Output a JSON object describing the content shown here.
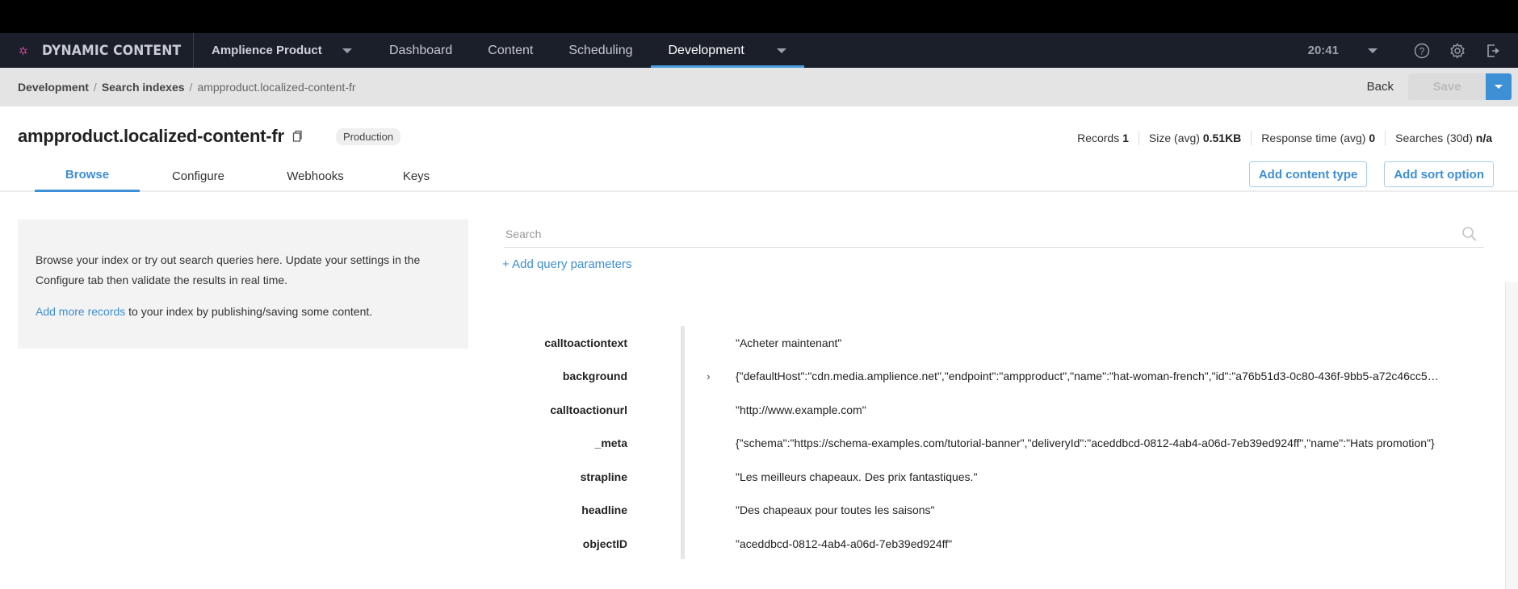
{
  "nav": {
    "brand": "DYNAMIC CONTENT",
    "hub": "Amplience Product",
    "tabs": [
      {
        "label": "Dashboard",
        "active": false
      },
      {
        "label": "Content",
        "active": false
      },
      {
        "label": "Scheduling",
        "active": false
      },
      {
        "label": "Development",
        "active": true
      }
    ],
    "clock": "20:41",
    "icons": [
      "help-icon",
      "gear-icon",
      "logout-icon"
    ],
    "accent": "#4a9de0"
  },
  "breadcrumb": {
    "items": [
      "Development",
      "Search indexes",
      "ampproduct.localized-content-fr"
    ],
    "back_label": "Back",
    "save_label": "Save"
  },
  "header": {
    "title": "ampproduct.localized-content-fr",
    "badge": "Production",
    "stats": [
      {
        "label": "Records",
        "value": "1"
      },
      {
        "label": "Size (avg)",
        "value": "0.51KB"
      },
      {
        "label": "Response time (avg)",
        "value": "0"
      },
      {
        "label": "Searches (30d)",
        "value": "n/a"
      }
    ],
    "tabs": [
      {
        "label": "Browse",
        "active": true
      },
      {
        "label": "Configure",
        "active": false
      },
      {
        "label": "Webhooks",
        "active": false
      },
      {
        "label": "Keys",
        "active": false
      }
    ],
    "add_content_type": "Add content type",
    "add_sort_option": "Add sort option"
  },
  "info": {
    "line1": "Browse your index or try out search queries here. Update your settings in the Configure tab then validate the results in real time.",
    "link": "Add more records",
    "line2_rest": " to your index by publishing/saving some content."
  },
  "search": {
    "placeholder": "Search",
    "value": "",
    "add_query": "+ Add query parameters"
  },
  "record": [
    {
      "key": "calltoactiontext",
      "expandable": false,
      "value": "\"Acheter maintenant\""
    },
    {
      "key": "background",
      "expandable": true,
      "value": "{\"defaultHost\":\"cdn.media.amplience.net\",\"endpoint\":\"ampproduct\",\"name\":\"hat-woman-french\",\"id\":\"a76b51d3-0c80-436f-9bb5-a72c46cc5…"
    },
    {
      "key": "calltoactionurl",
      "expandable": false,
      "value": "\"http://www.example.com\""
    },
    {
      "key": "_meta",
      "expandable": false,
      "value": "{\"schema\":\"https://schema-examples.com/tutorial-banner\",\"deliveryId\":\"aceddbcd-0812-4ab4-a06d-7eb39ed924ff\",\"name\":\"Hats promotion\"}"
    },
    {
      "key": "strapline",
      "expandable": false,
      "value": "\"Les meilleurs chapeaux. Des prix fantastiques.\""
    },
    {
      "key": "headline",
      "expandable": false,
      "value": "\"Des chapeaux pour toutes les saisons\""
    },
    {
      "key": "objectID",
      "expandable": false,
      "value": "\"aceddbcd-0812-4ab4-a06d-7eb39ed924ff\""
    }
  ]
}
